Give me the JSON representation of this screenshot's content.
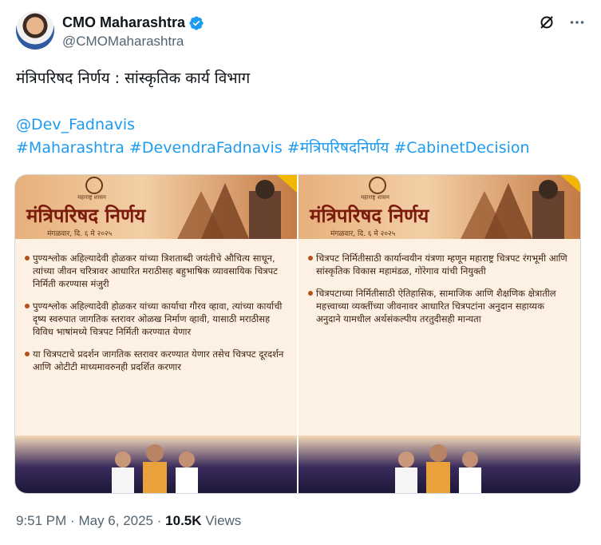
{
  "author": {
    "display_name": "CMO Maharashtra",
    "handle": "@CMOMaharashtra",
    "verified": true
  },
  "tweet": {
    "line1": "मंत्रिपरिषद निर्णय : सांस्कृतिक कार्य विभाग",
    "mention": "@Dev_Fadnavis",
    "hashtags": [
      "#Maharashtra",
      "#DevendraFadnavis",
      "#मंत्रिपरिषदनिर्णय",
      "#CabinetDecision"
    ]
  },
  "media": [
    {
      "seal_label": "महाराष्ट्र शासन",
      "title": "मंत्रिपरिषद निर्णय",
      "date": "मंगळवार, दि. ६ मे २०२५",
      "points": [
        "पुण्यश्लोक अहिल्यादेवी होळकर यांच्या त्रिशताब्दी जयंतीचे औचित्य साधून, त्यांच्या जीवन चरित्रावर आधारित मराठीसह बहुभाषिक व्यावसायिक चित्रपट निर्मिती करण्यास मंजुरी",
        "पुण्यश्लोक अहिल्यादेवी होळकर यांच्या कार्याचा गौरव व्हावा, त्यांच्या कार्याची दृष्य स्वरुपात जागतिक स्तरावर ओळख निर्माण व्हावी, यासाठी मराठीसह विविध भाषांमध्ये चित्रपट निर्मिती करण्यात येणार",
        "या चित्रपटाचे प्रदर्शन जागतिक स्तरावर करण्यात येणार तसेच चित्रपट दूरदर्शन आणि ओटीटी माध्यमावरुनही प्रदर्शित करणार"
      ]
    },
    {
      "seal_label": "महाराष्ट्र शासन",
      "title": "मंत्रिपरिषद निर्णय",
      "date": "मंगळवार, दि. ६ मे २०२५",
      "points": [
        "चित्रपट निर्मितीसाठी कार्यान्वयीन यंत्रणा म्हणून महाराष्ट्र चित्रपट रंगभूमी आणि सांस्कृतिक विकास महामंडळ, गोरेगाव यांची नियुक्ती",
        "चित्रपटाच्या निर्मितीसाठी ऐतिहासिक, सामाजिक आणि शैक्षणिक क्षेत्रातील महत्त्वाच्या व्यक्तींच्या जीवनावर आधारित चित्रपटांना अनुदान सहाय्यक अनुदाने यामधील अर्थसंकल्पीय तरतुदीसही मान्यता"
      ]
    }
  ],
  "meta": {
    "time": "9:51 PM",
    "date": "May 6, 2025",
    "views_count": "10.5K",
    "views_label": "Views",
    "separator": "·"
  },
  "icons": {
    "grok": "grok-icon",
    "more": "more-icon",
    "verified": "verified-badge-icon"
  },
  "colors": {
    "link": "#1d9bf0",
    "verified": "#1d9bf0",
    "muted": "#536471",
    "accent_title": "#7a1b0e"
  }
}
